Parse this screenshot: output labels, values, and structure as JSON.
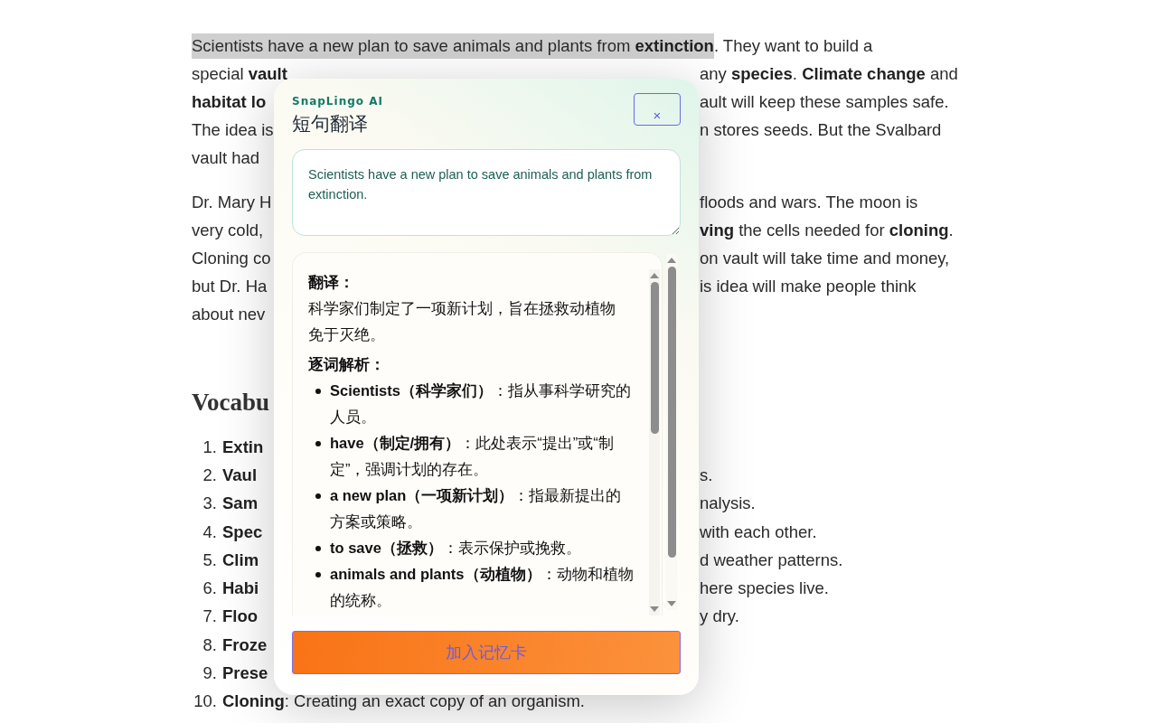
{
  "article": {
    "paragraphs": [
      {
        "lines": [
          {
            "highlight": "Scientists have a new plan to save animals and plants from **extinction**",
            "left": ". They want to build a"
          },
          {
            "left": "special **vault**",
            "right": "any **species**. **Climate change** and"
          },
          {
            "left": "**habitat lo**",
            "right": "ault will keep these samples safe."
          },
          {
            "left": "The idea is",
            "right": "n stores seeds. But the Svalbard"
          },
          {
            "left": "vault had"
          }
        ]
      },
      {
        "lines": [
          {
            "left": "Dr. Mary H",
            "right": "floods and wars. The moon is"
          },
          {
            "left": "very cold,",
            "right": "**ving** the cells needed for **cloning**."
          },
          {
            "left": "Cloning co",
            "right": "on vault will take time and money,"
          },
          {
            "left": "but Dr. Ha",
            "right": "is idea will make people think"
          },
          {
            "left": "about nev"
          }
        ]
      }
    ],
    "heading": "Vocabu",
    "vocabulary": [
      {
        "number": "1.",
        "left": "**Extin**"
      },
      {
        "number": "2.",
        "left": "**Vaul**",
        "right": "s."
      },
      {
        "number": "3.",
        "left": "**Sam**",
        "right": "nalysis."
      },
      {
        "number": "4.",
        "left": "**Spec**",
        "right": "with each other."
      },
      {
        "number": "5.",
        "left": "**Clim**",
        "right": "d weather patterns."
      },
      {
        "number": "6.",
        "left": "**Habi**",
        "right": "here species live."
      },
      {
        "number": "7.",
        "left": "**Floo**",
        "right": "y dry."
      },
      {
        "number": "8.",
        "left": "**Froze**"
      },
      {
        "number": "9.",
        "left": "**Prese**"
      },
      {
        "number": "10.",
        "left": "**Cloning**: Creating an exact copy of an organism."
      }
    ]
  },
  "popup": {
    "brand": "SnapLingo AI",
    "title": "短句翻译",
    "close_label": "×",
    "source_text": "Scientists have a new plan to save animals and plants from extinction.",
    "result": {
      "translation_label": "翻译：",
      "translation": "科学家们制定了一项新计划，旨在拯救动植物免于灭绝。",
      "analysis_label": "逐词解析：",
      "analysis": [
        "**Scientists（科学家们）**：指从事科学研究的人员。",
        "**have（制定/拥有）**：此处表示“提出”或“制定”，强调计划的存在。",
        "**a new plan（一项新计划）**：指最新提出的方案或策略。",
        "**to save（拯救）**：表示保护或挽救。",
        "**animals and plants（动植物）**：动物和植物的统称。"
      ]
    },
    "action_button": "加入记忆卡"
  }
}
